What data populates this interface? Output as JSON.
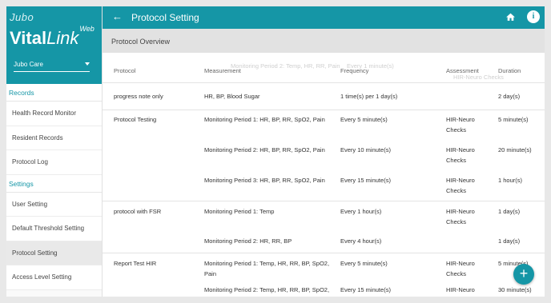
{
  "brand": {
    "company": "Jubo",
    "product_bold": "Vital",
    "product_italic": "Link",
    "product_sup": "Web"
  },
  "org_select": {
    "value": "Jubo Care"
  },
  "nav": {
    "records_label": "Records",
    "records_items": [
      "Health Record Monitor",
      "Resident Records",
      "Protocol Log"
    ],
    "settings_label": "Settings",
    "settings_items": [
      "User Setting",
      "Default Threshold Setting",
      "Protocol Setting",
      "Access Level Setting"
    ],
    "active": "Protocol Setting"
  },
  "header": {
    "title": "Protocol Setting",
    "back_icon": "arrow-left-icon",
    "home_icon": "home-icon",
    "info_icon": "info-icon",
    "info_glyph": "i"
  },
  "section": {
    "title": "Protocol Overview"
  },
  "table": {
    "columns": [
      "Protocol",
      "Measurement",
      "Frequency",
      "Assessment",
      "Duration"
    ],
    "ghost_text": {
      "measurement": "Monitoring Period 2: Temp, HR, RR, Pain",
      "frequency": "Every 1 minute(s)",
      "assessment": "HIR-Neuro Checks"
    },
    "rows": [
      {
        "protocol": "progress note only",
        "measurement": "HR, BP, Blood Sugar",
        "frequency": "1 time(s) per 1 day(s)",
        "assessment": "",
        "duration": "2 day(s)"
      },
      {
        "protocol": "Protocol Testing",
        "measurement": "Monitoring Period 1: HR, BP, RR, SpO2, Pain",
        "frequency": "Every 5 minute(s)",
        "assessment": "HIR-Neuro Checks",
        "duration": "5 minute(s)"
      },
      {
        "protocol": "",
        "measurement": "Monitoring Period 2: HR, BP, RR, SpO2, Pain",
        "frequency": "Every 10 minute(s)",
        "assessment": "HIR-Neuro Checks",
        "duration": "20 minute(s)"
      },
      {
        "protocol": "",
        "measurement": "Monitoring Period 3: HR, BP, RR, SpO2, Pain",
        "frequency": "Every 15 minute(s)",
        "assessment": "HIR-Neuro Checks",
        "duration": "1 hour(s)"
      },
      {
        "protocol": "protocol with FSR",
        "measurement": "Monitoring Period 1: Temp",
        "frequency": "Every 1 hour(s)",
        "assessment": "HIR-Neuro Checks",
        "duration": "1 day(s)"
      },
      {
        "protocol": "",
        "measurement": "Monitoring Period 2: HR, RR, BP",
        "frequency": "Every 4 hour(s)",
        "assessment": "",
        "duration": "1 day(s)"
      },
      {
        "protocol": "Report Test HIR",
        "measurement": "Monitoring Period 1: Temp, HR, RR, BP, SpO2, Pain",
        "frequency": "Every 5 minute(s)",
        "assessment": "HIR-Neuro Checks",
        "duration": "5 minute(s)"
      },
      {
        "protocol": "",
        "measurement": "Monitoring Period 2: Temp, HR, RR, BP, SpO2,",
        "frequency": "Every 15 minute(s)",
        "assessment": "HIR-Neuro",
        "duration": "30 minute(s)"
      }
    ]
  },
  "fab": {
    "label": "+"
  },
  "colors": {
    "primary": "#1596a6",
    "subbar": "#e2e2e2",
    "active_nav": "#e9e9e9"
  }
}
